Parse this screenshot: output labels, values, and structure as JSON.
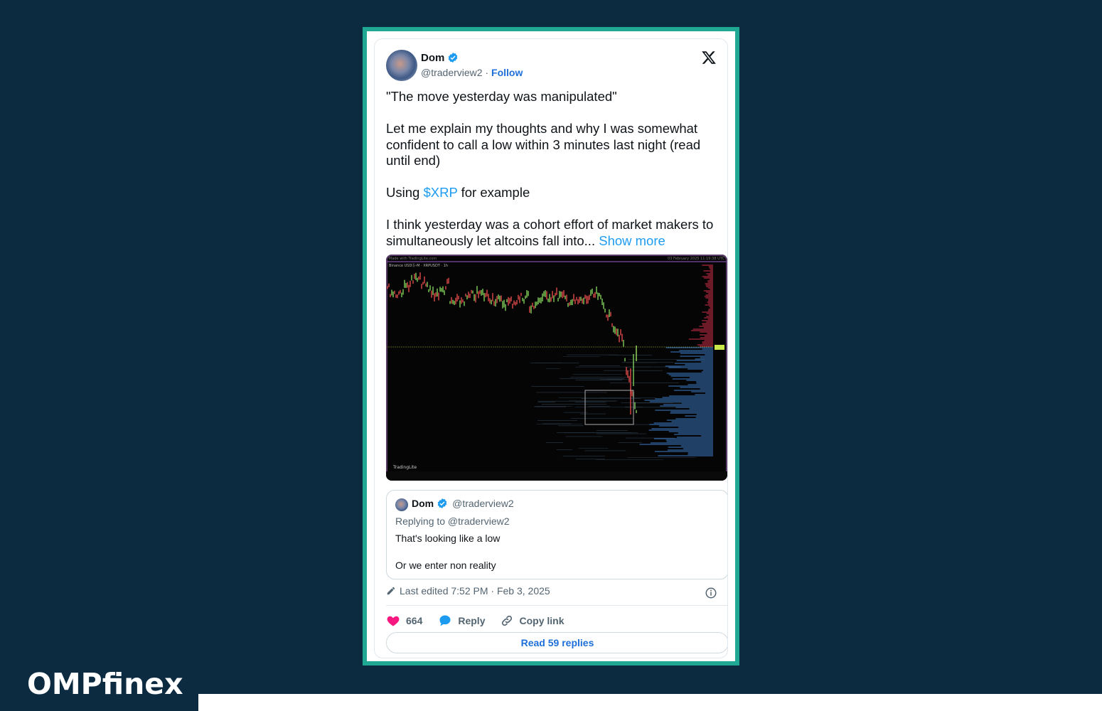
{
  "tweet": {
    "author_name": "Dom",
    "handle": "@traderview2",
    "separator": "·",
    "follow_label": "Follow",
    "text_before_link": "\"The move yesterday was manipulated\"\n\nLet me explain my thoughts and why I was somewhat confident to call a low within 3 minutes last night (read until end)\n\nUsing ",
    "cashtag": "$XRP",
    "text_after_link": " for example\n\nI think yesterday was a cohort effort of market makers to simultaneously let altcoins fall into... ",
    "show_more_label": "Show more",
    "chart_image": {
      "watermark_top_left": "Made with TradingLite.com",
      "symbol_label": "Binance USDⓈ-M · XRPUSDT · 1h",
      "timestamp_top_right": "03 February 2025 11:19:38 UTC",
      "brand_bottom_left": "TradingLite"
    },
    "quote": {
      "author_name": "Dom",
      "handle": "@traderview2",
      "replying_to": "Replying to @traderview2",
      "text": "That's looking like a low\n\nOr we enter non reality"
    },
    "edited_label": "Last edited 7:52 PM · Feb 3, 2025",
    "likes_count": "664",
    "reply_label": "Reply",
    "copy_link_label": "Copy link",
    "read_replies_label": "Read 59 replies"
  },
  "brand": {
    "part1": "OMP",
    "part2": "f",
    "part3": "i",
    "part4": "nex"
  },
  "colors": {
    "background": "#0d2b40",
    "frame_accent": "#1fa893",
    "link_blue": "#1d9bf0",
    "heart_pink": "#f91880"
  },
  "icons": {
    "verified": "verified-badge-icon",
    "x_logo": "x-logo-icon",
    "edit": "pencil-icon",
    "info": "info-icon",
    "like": "heart-icon",
    "reply": "speech-bubble-icon",
    "copy": "link-icon"
  }
}
